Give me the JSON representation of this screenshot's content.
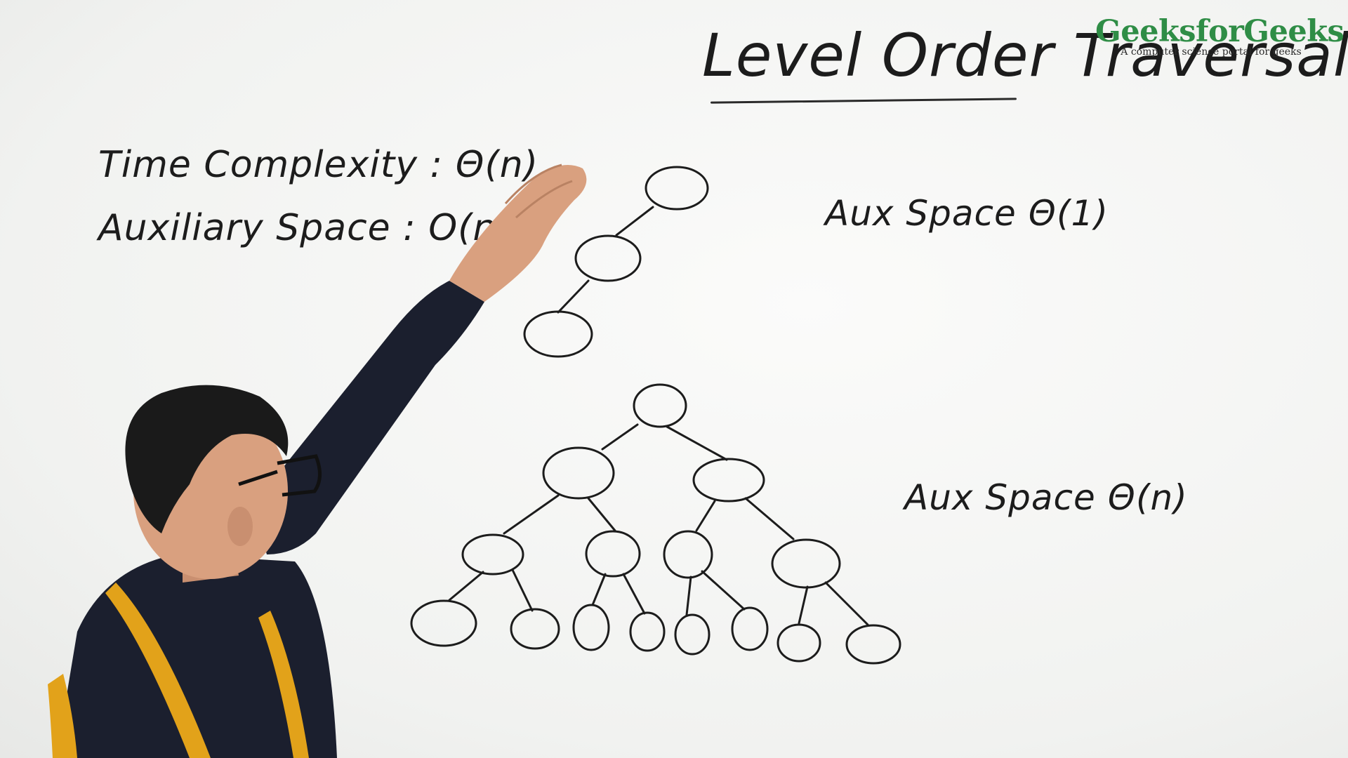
{
  "board": {
    "title": "Level Order Traversal",
    "time_complexity": "Time Complexity : Θ(n)",
    "auxiliary_space": "Auxiliary Space : O(n)",
    "skewed_tree_aux": "Aux Space  Θ(1)",
    "complete_tree_aux": "Aux Space  Θ(n)"
  },
  "logo": {
    "name": "GeeksforGeeks",
    "tagline": "A computer science portal for geeks",
    "color": "#2f8d46"
  },
  "colors": {
    "ink": "#1c1c1c",
    "jacket": "#1b1f2e",
    "jacket_stripe": "#e2a21a",
    "skin": "#d9a07f",
    "hair": "#1a1a1a"
  }
}
